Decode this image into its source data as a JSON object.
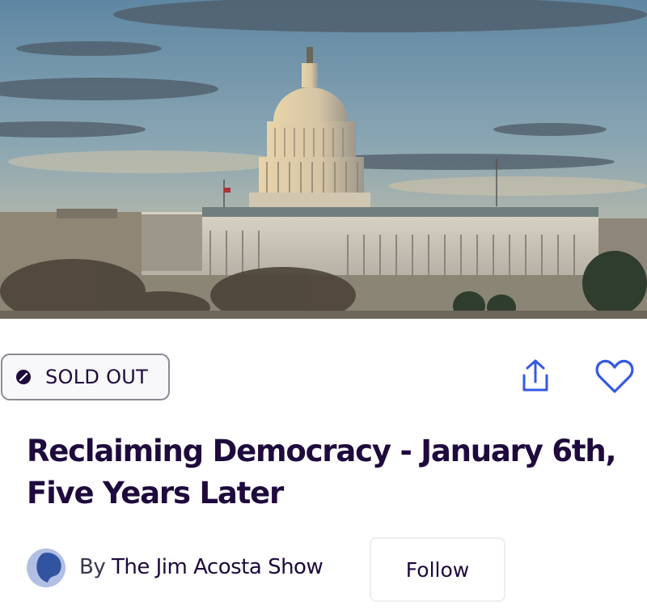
{
  "hero": {
    "image_subject": "capitol-building-at-sunrise"
  },
  "status": {
    "label": "SOLD OUT"
  },
  "actions": {
    "share_icon": "share-icon",
    "like_icon": "heart-icon"
  },
  "event": {
    "title": "Reclaiming Democracy - January 6th, Five Years Later"
  },
  "organizer": {
    "by_label": "By",
    "name": "The Jim Acosta Show",
    "follow_label": "Follow"
  },
  "colors": {
    "title": "#1e0a3c",
    "accent_blue": "#3659e3",
    "avatar": "#b1bfe5"
  }
}
